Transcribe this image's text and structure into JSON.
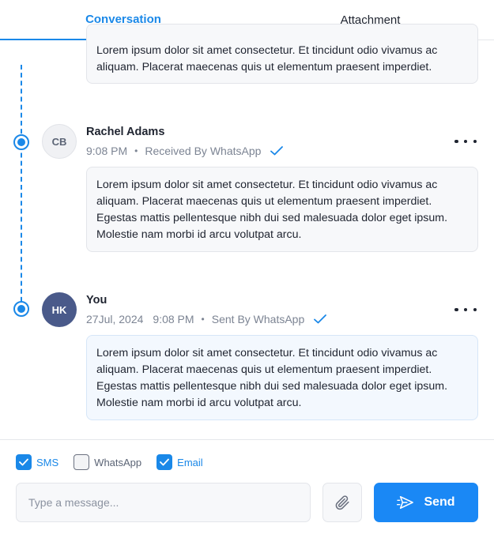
{
  "tabs": [
    {
      "label": "Conversation",
      "active": true
    },
    {
      "label": "Attachment",
      "active": false
    }
  ],
  "messages": [
    {
      "body": "Lorem ipsum dolor sit amet consectetur. Et tincidunt odio vivamus ac aliquam. Placerat maecenas quis ut elementum praesent imperdiet."
    },
    {
      "initials": "CB",
      "sender": "Rachel Adams",
      "time": "9:08 PM",
      "separator": "•",
      "status": "Received By WhatsApp",
      "body": "Lorem ipsum dolor sit amet consectetur. Et tincidunt odio vivamus ac aliquam. Placerat maecenas quis ut elementum praesent imperdiet. Egestas mattis pellentesque nibh dui sed malesuada dolor eget ipsum. Molestie nam morbi id arcu volutpat arcu."
    },
    {
      "initials": "HK",
      "sender": "You",
      "date": "27Jul, 2024",
      "time": "9:08 PM",
      "separator": "•",
      "status": "Sent By WhatsApp",
      "body": "Lorem ipsum dolor sit amet consectetur. Et tincidunt odio vivamus ac aliquam. Placerat maecenas quis ut elementum praesent imperdiet. Egestas mattis pellentesque nibh dui sed malesuada dolor eget ipsum. Molestie nam morbi id arcu volutpat arcu."
    }
  ],
  "channels": [
    {
      "label": "SMS",
      "checked": true
    },
    {
      "label": "WhatsApp",
      "checked": false
    },
    {
      "label": "Email",
      "checked": true
    }
  ],
  "composer": {
    "placeholder": "Type a message...",
    "value": "",
    "send_label": "Send"
  },
  "icons": {
    "check": "check-icon",
    "more": "more-horizontal-icon",
    "attach": "paperclip-icon",
    "send": "send-icon"
  },
  "colors": {
    "accent": "#1a88e8",
    "send_button": "#1a88f5",
    "avatar_dark": "#4a5a8a",
    "text": "#1f2430",
    "muted": "#7c8493"
  }
}
